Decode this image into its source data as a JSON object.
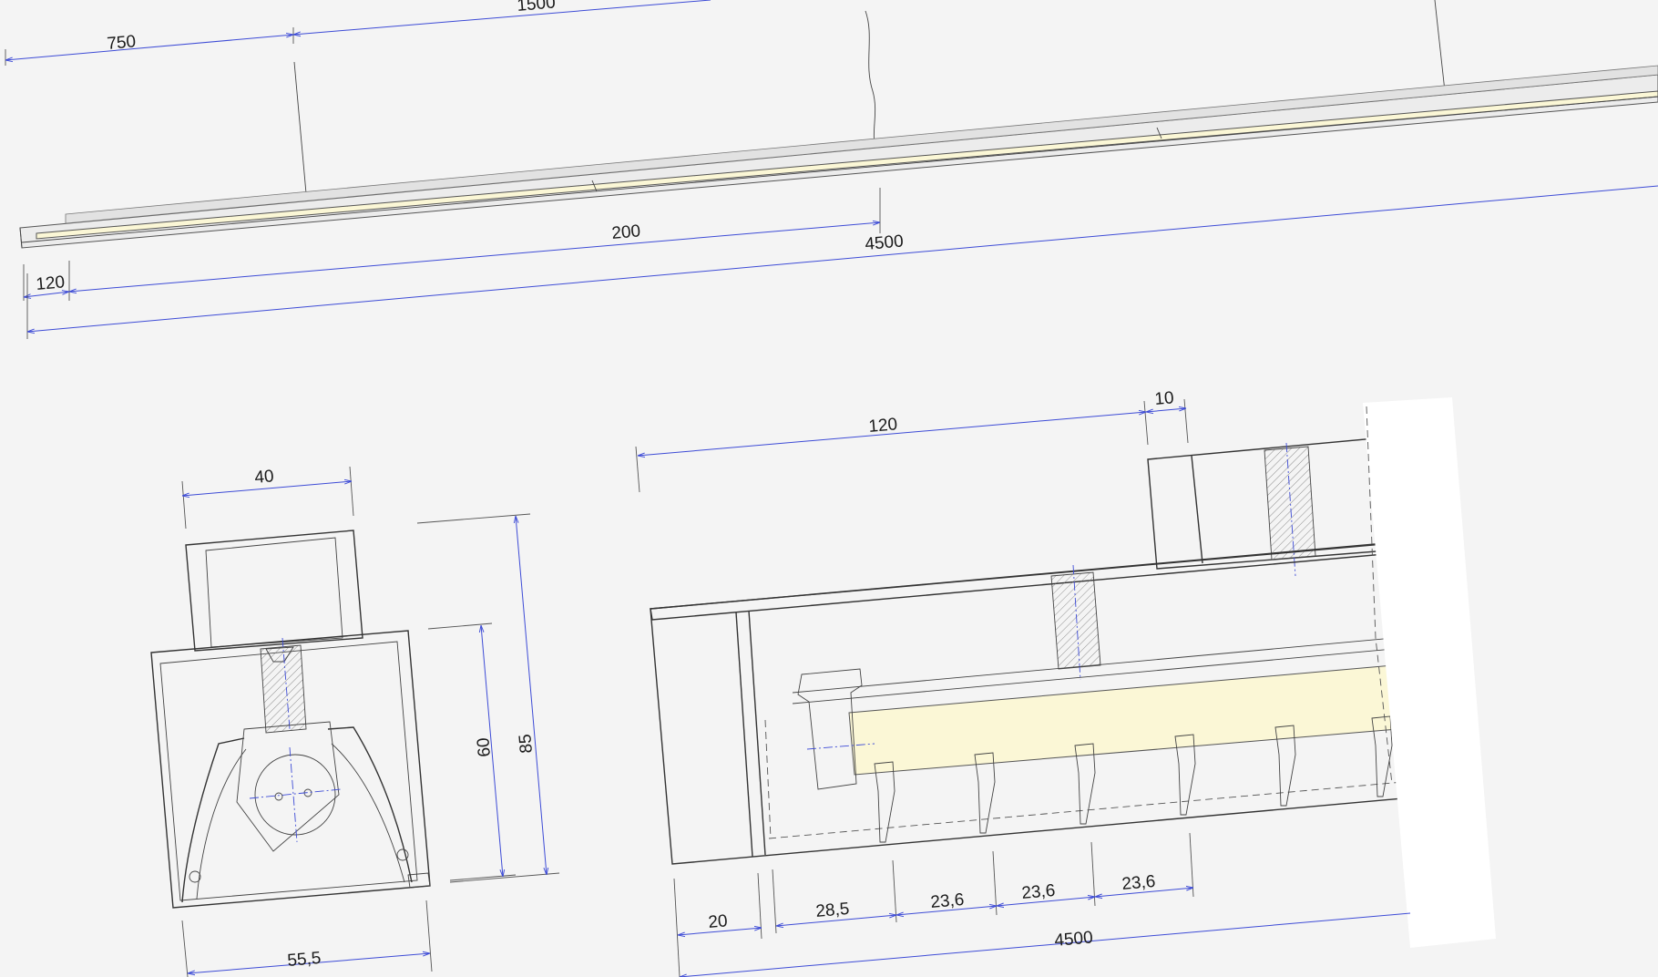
{
  "dimensions": {
    "top_view": {
      "d750": "750",
      "d1500": "1500",
      "d200": "200",
      "d4500": "4500",
      "d120": "120"
    },
    "cross_section": {
      "d40": "40",
      "d60": "60",
      "d85": "85",
      "d55_5": "55,5"
    },
    "side_detail": {
      "d120": "120",
      "d10": "10",
      "d20": "20",
      "d28_5": "28,5",
      "d23_6_a": "23,6",
      "d23_6_b": "23,6",
      "d23_6_c": "23,6",
      "d4500": "4500"
    }
  },
  "colors": {
    "dimension": "#3d4bd6",
    "led_strip": "#fbf7d6",
    "background": "#f4f4f4"
  }
}
